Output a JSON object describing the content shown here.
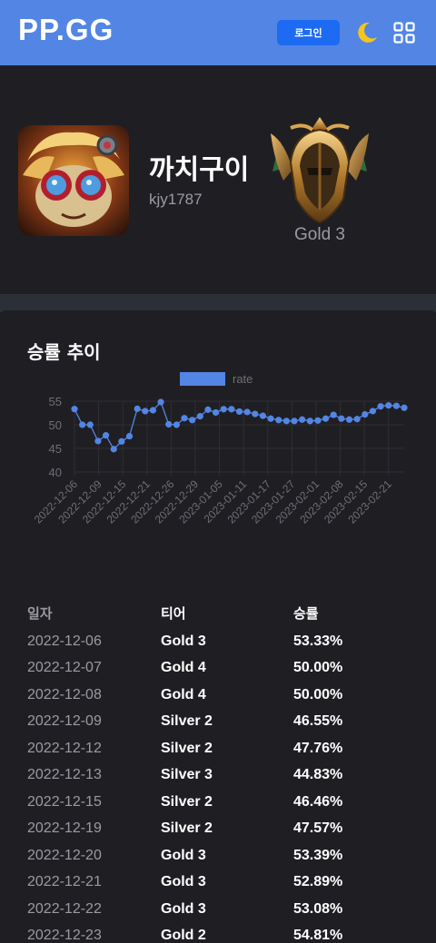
{
  "header": {
    "logo": "PP.GG",
    "login_label": "로그인",
    "icons": [
      "moon-icon",
      "grid-icon"
    ],
    "color": "#5385e4",
    "button_color": "#1c6bf2"
  },
  "profile": {
    "name": "까치구이",
    "tag": "kjy1787",
    "tier": "Gold 3"
  },
  "card": {
    "title": "승률 추이"
  },
  "chart_data": {
    "type": "line",
    "legend": "rate",
    "legend_position": "top",
    "color": "#5385e4",
    "ylim": [
      40,
      55
    ],
    "yticks": [
      40,
      45,
      50,
      55
    ],
    "grid": true,
    "tick_labels": [
      "2022-12-06",
      "2022-12-09",
      "2022-12-15",
      "2022-12-21",
      "2022-12-26",
      "2022-12-29",
      "2023-01-05",
      "2023-01-11",
      "2023-01-17",
      "2023-01-27",
      "2023-02-01",
      "2023-02-08",
      "2023-02-15",
      "2023-02-21"
    ],
    "values": [
      53.33,
      50.0,
      50.0,
      46.55,
      47.76,
      44.83,
      46.46,
      47.57,
      53.39,
      52.89,
      53.08,
      54.81,
      50.1,
      50.0,
      51.4,
      51.0,
      51.8,
      53.2,
      52.6,
      53.3,
      53.3,
      52.8,
      52.7,
      52.3,
      51.9,
      51.3,
      51.0,
      50.8,
      50.8,
      51.1,
      50.8,
      50.9,
      51.3,
      52.1,
      51.3,
      51.1,
      51.2,
      52.2,
      52.9,
      53.9,
      54.1,
      54.0,
      53.6
    ]
  },
  "table": {
    "headers": [
      "일자",
      "티어",
      "승률"
    ],
    "rows": [
      {
        "date": "2022-12-06",
        "tier": "Gold 3",
        "rate": "53.33%"
      },
      {
        "date": "2022-12-07",
        "tier": "Gold 4",
        "rate": "50.00%"
      },
      {
        "date": "2022-12-08",
        "tier": "Gold 4",
        "rate": "50.00%"
      },
      {
        "date": "2022-12-09",
        "tier": "Silver 2",
        "rate": "46.55%"
      },
      {
        "date": "2022-12-12",
        "tier": "Silver 2",
        "rate": "47.76%"
      },
      {
        "date": "2022-12-13",
        "tier": "Silver 3",
        "rate": "44.83%"
      },
      {
        "date": "2022-12-15",
        "tier": "Silver 2",
        "rate": "46.46%"
      },
      {
        "date": "2022-12-19",
        "tier": "Silver 2",
        "rate": "47.57%"
      },
      {
        "date": "2022-12-20",
        "tier": "Gold 3",
        "rate": "53.39%"
      },
      {
        "date": "2022-12-21",
        "tier": "Gold 3",
        "rate": "52.89%"
      },
      {
        "date": "2022-12-22",
        "tier": "Gold 3",
        "rate": "53.08%"
      },
      {
        "date": "2022-12-23",
        "tier": "Gold 2",
        "rate": "54.81%"
      }
    ]
  }
}
